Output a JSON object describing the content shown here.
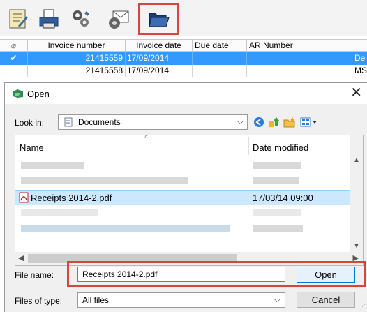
{
  "toolbar": {
    "icons": [
      "report-icon",
      "printer-icon",
      "tools-icon",
      "mail-icon",
      "folder-open-icon"
    ]
  },
  "grid": {
    "columns": [
      "Invoice number",
      "Invoice date",
      "Due date",
      "AR Number"
    ],
    "rows": [
      {
        "number": "21415559",
        "date": "17/09/2014",
        "extra": "De"
      },
      {
        "number": "21415558",
        "date": "17/09/2014",
        "extra": "MS"
      }
    ]
  },
  "dialog": {
    "title": "Open",
    "close_glyph": "✕",
    "look_in_label": "Look in:",
    "look_in_value": "Documents",
    "columns": {
      "name": "Name",
      "date": "Date modified"
    },
    "files": [
      {
        "name": "Receipts 2014-2.pdf",
        "date": "17/03/14 09:00"
      }
    ],
    "file_name_label": "File name:",
    "file_name_value": "Receipts 2014-2.pdf",
    "files_of_type_label": "Files of type:",
    "files_of_type_value": "All files",
    "open_label": "Open",
    "cancel_label": "Cancel"
  }
}
